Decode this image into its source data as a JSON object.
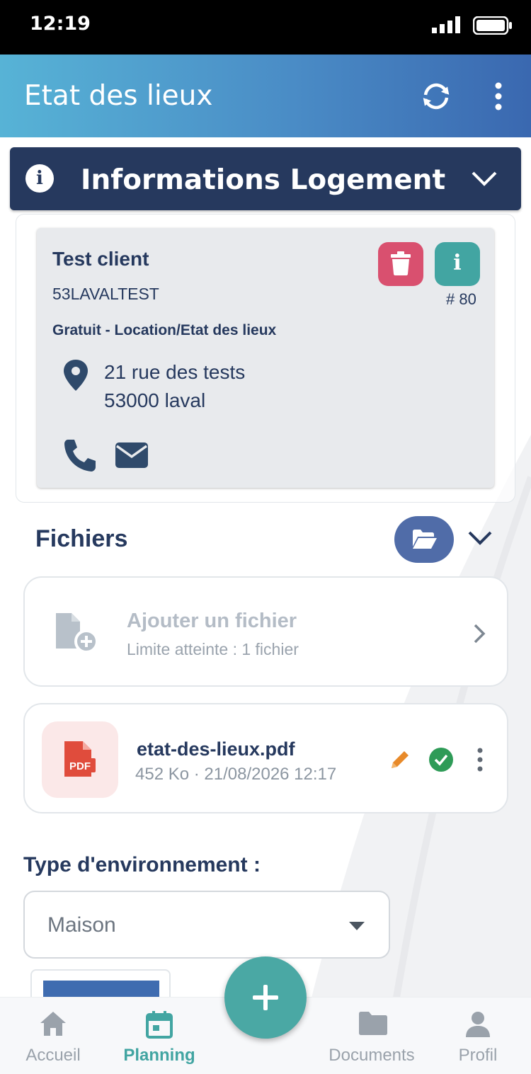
{
  "status_bar": {
    "time": "12:19"
  },
  "app_bar": {
    "title": "Etat des lieux",
    "sync_icon": "sync-icon",
    "menu_icon": "more-vertical-icon"
  },
  "section": {
    "title": "Informations Logement",
    "icon": "info-circle-icon",
    "toggle_icon": "chevron-down-icon"
  },
  "client": {
    "name": "Test client",
    "code": "53LAVALTEST",
    "id_label": "# 80",
    "type": "Gratuit - Location/Etat des lieux",
    "address_line1": "21 rue des tests",
    "address_line2": "53000 laval",
    "delete_icon": "trash-icon",
    "info_button_label": "i",
    "phone_icon": "phone-icon",
    "mail_icon": "envelope-icon"
  },
  "files": {
    "title": "Fichiers",
    "folder_icon": "folder-open-icon",
    "add": {
      "title": "Ajouter un fichier",
      "subtitle": "Limite atteinte : 1 fichier"
    },
    "items": [
      {
        "name": "etat-des-lieux.pdf",
        "meta": "452 Ko · 21/08/2026 12:17",
        "badge": "PDF"
      }
    ]
  },
  "environment": {
    "label": "Type d'environnement :",
    "selected": "Maison"
  },
  "bottom_nav": {
    "items": [
      {
        "label": "Accueil",
        "icon": "home-icon"
      },
      {
        "label": "Planning",
        "icon": "calendar-icon",
        "active": true
      },
      {
        "label": "Documents",
        "icon": "folder-icon"
      },
      {
        "label": "Profil",
        "icon": "user-icon"
      }
    ],
    "fab_icon": "plus-icon"
  },
  "colors": {
    "primary": "#26395e",
    "accent": "#42a5a2",
    "danger": "#d9506f",
    "header_start": "#57b3d6",
    "header_end": "#3a68b0"
  }
}
